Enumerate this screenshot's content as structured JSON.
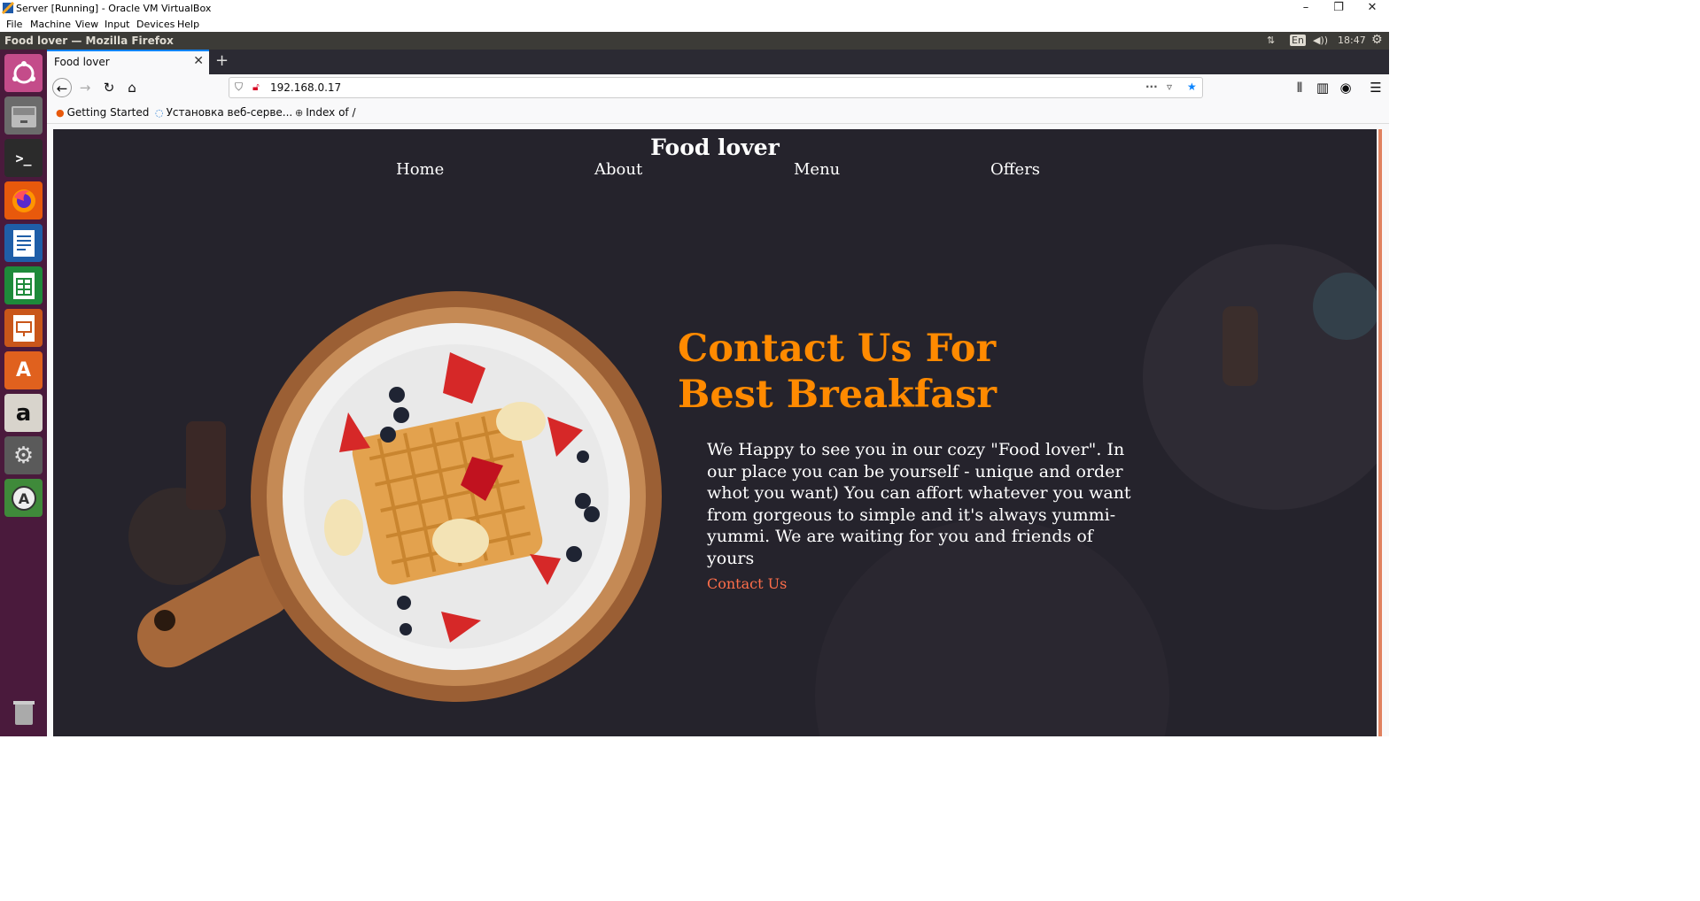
{
  "vbox": {
    "title": "Server [Running] - Oracle VM VirtualBox",
    "menu": [
      "File",
      "Machine",
      "View",
      "Input",
      "Devices",
      "Help"
    ],
    "controls": [
      "–",
      "❐",
      "✕"
    ]
  },
  "ubuntu": {
    "window_title": "Food lover — Mozilla Firefox",
    "lang": "En",
    "clock": "18:47"
  },
  "firefox": {
    "tab_title": "Food lover",
    "tab_close": "✕",
    "new_tab": "+",
    "url": "192.168.0.17",
    "bookmarks": [
      {
        "label": "Getting Started",
        "icon": "firefox-icon"
      },
      {
        "label": "Установка веб-серве...",
        "icon": "loading-icon"
      },
      {
        "label": "Index of /",
        "icon": "globe-icon"
      }
    ]
  },
  "site": {
    "title": "Food lover",
    "nav": [
      "Home",
      "About",
      "Menu",
      "Offers"
    ],
    "hero_line1": "Contact Us For",
    "hero_line2": "Best Breakfasr",
    "description": "We Happy to see you in our cozy \"Food lover\". In our place you can be yourself - unique and order whot you want) You can affort whatever you want from gorgeous to simple and it's always yummi-yummi. We are waiting for you and friends of yours",
    "contact_link": "Contact Us"
  },
  "colors": {
    "hero_accent": "#ff8a00",
    "link": "#ff6e4a",
    "site_bg": "#25232c",
    "launcher_bg": "#4a1a3c"
  }
}
